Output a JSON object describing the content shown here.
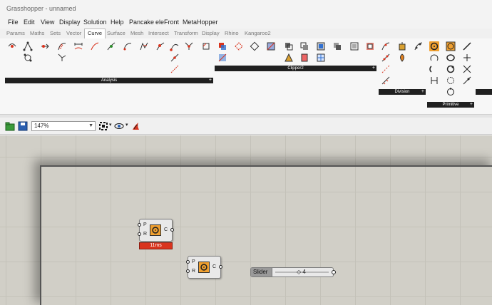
{
  "window": {
    "title": "Grasshopper - unnamed"
  },
  "menu": [
    "File",
    "Edit",
    "View",
    "Display",
    "Solution",
    "Help",
    "Pancake",
    "eleFront",
    "MetaHopper"
  ],
  "tabs": [
    "Params",
    "Maths",
    "Sets",
    "Vector",
    "Curve",
    "Surface",
    "Mesh",
    "Intersect",
    "Transform",
    "Display",
    "Rhino",
    "Kangaroo2"
  ],
  "active_tab": "Curve",
  "ribbon_groups": {
    "analysis": {
      "label": "Analysis",
      "expand": "+"
    },
    "clipper": {
      "label": "Clipper2",
      "expand": "+"
    },
    "division": {
      "label": "Division",
      "expand": "+"
    },
    "primitive": {
      "label": "Primitive",
      "expand": "+"
    }
  },
  "toolbar": {
    "zoom": "147%",
    "zoom_arrow": "▼",
    "dropdown_arrow": "▾"
  },
  "canvas": {
    "component_1": {
      "in_top": "P",
      "in_bottom": "R",
      "out": "C",
      "runtime": "11ms"
    },
    "component_2": {
      "in_top": "P",
      "in_bottom": "R",
      "out": "C"
    },
    "slider": {
      "label": "Slider",
      "value": "4",
      "marker": "◇"
    }
  },
  "colors": {
    "accent_orange": "#f0a030",
    "runtime_red": "#d9341e",
    "canvas_bg": "#d1cfc7"
  }
}
